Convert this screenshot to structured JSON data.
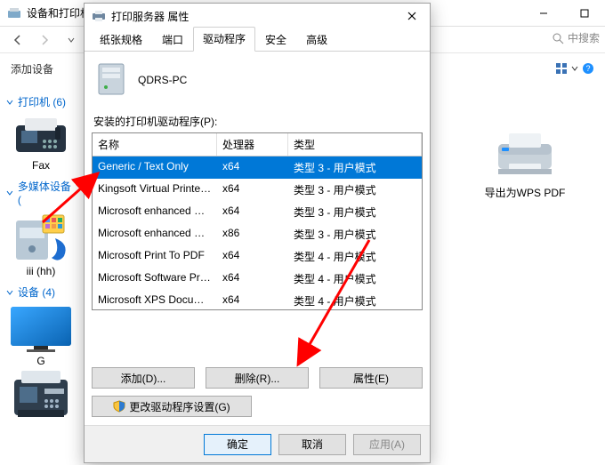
{
  "main_window": {
    "title": "设备和打印机",
    "add_device": "添加设备",
    "search_hint": "中搜索"
  },
  "sidebar": {
    "printers_header": "打印机 (6)",
    "fax_label": "Fax",
    "media_header": "多媒体设备 (",
    "media_label": "iii (hh)",
    "devices_header": "设备 (4)",
    "device_g_label": "G"
  },
  "content": {
    "wps_label": "导出为WPS PDF"
  },
  "dialog": {
    "title": "打印服务器 属性",
    "tabs": [
      "纸张规格",
      "端口",
      "驱动程序",
      "安全",
      "高级"
    ],
    "server_name": "QDRS-PC",
    "section_label": "安装的打印机驱动程序(P):",
    "columns": {
      "name": "名称",
      "processor": "处理器",
      "type": "类型"
    },
    "drivers": [
      {
        "name": "Generic / Text Only",
        "proc": "x64",
        "type": "类型 3 - 用户模式",
        "selected": true
      },
      {
        "name": "Kingsoft Virtual Printer ...",
        "proc": "x64",
        "type": "类型 3 - 用户模式",
        "selected": false
      },
      {
        "name": "Microsoft enhanced Poi...",
        "proc": "x64",
        "type": "类型 3 - 用户模式",
        "selected": false
      },
      {
        "name": "Microsoft enhanced Poi...",
        "proc": "x86",
        "type": "类型 3 - 用户模式",
        "selected": false
      },
      {
        "name": "Microsoft Print To PDF",
        "proc": "x64",
        "type": "类型 4 - 用户模式",
        "selected": false
      },
      {
        "name": "Microsoft Software Prin...",
        "proc": "x64",
        "type": "类型 4 - 用户模式",
        "selected": false
      },
      {
        "name": "Microsoft XPS Docume...",
        "proc": "x64",
        "type": "类型 4 - 用户模式",
        "selected": false
      }
    ],
    "buttons": {
      "add": "添加(D)...",
      "remove": "删除(R)...",
      "properties": "属性(E)",
      "driver_settings": "更改驱动程序设置(G)",
      "ok": "确定",
      "cancel": "取消",
      "apply": "应用(A)"
    }
  }
}
